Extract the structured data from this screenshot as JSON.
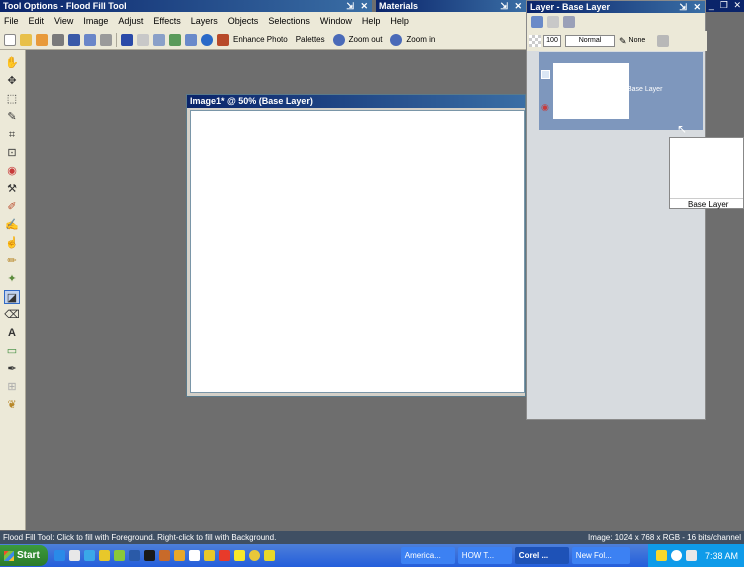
{
  "window_titles": {
    "tool_options": "Tool Options - Flood Fill Tool",
    "materials": "Materials",
    "layer_palette": "Layer - Base Layer",
    "image_window": "Image1* @  50% (Base Layer)"
  },
  "menu": [
    "File",
    "Edit",
    "View",
    "Image",
    "Adjust",
    "Effects",
    "Layers",
    "Objects",
    "Selections",
    "Window",
    "Help",
    "Help"
  ],
  "toolbar": {
    "enhance_photo": "Enhance Photo",
    "palettes": "Palettes",
    "zoom_out": "Zoom out",
    "zoom_in": "Zoom in"
  },
  "layer_palette": {
    "opacity": "100",
    "blend_mode": "Normal",
    "mask": "None",
    "layer_name": "Base Layer",
    "popup_name": "Base Layer"
  },
  "status": {
    "hint": "Flood Fill Tool: Click to fill with Foreground. Right-click to fill with Background.",
    "image_info": "Image:  1024 x 768 x RGB - 16 bits/channel"
  },
  "taskbar": {
    "start": "Start",
    "tasks": [
      "America...",
      "HOW T...",
      "Corel ...",
      "New Fol..."
    ],
    "clock": "7:38 AM"
  },
  "colors": {
    "title_blue": "#0a246a",
    "layer_selected": "#7e97bd",
    "workspace": "#6e6e6e"
  }
}
